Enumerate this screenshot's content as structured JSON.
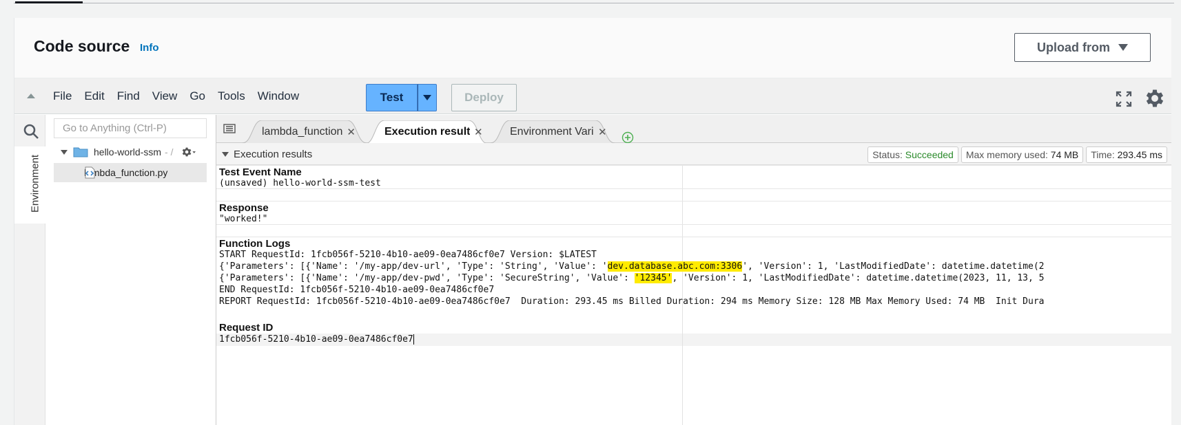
{
  "header": {
    "title": "Code source",
    "info_link": "Info",
    "upload_label": "Upload from"
  },
  "menubar": {
    "items": [
      "File",
      "Edit",
      "Find",
      "View",
      "Go",
      "Tools",
      "Window"
    ],
    "test_label": "Test",
    "deploy_label": "Deploy"
  },
  "sidebar": {
    "env_tab_label": "Environment",
    "goto_placeholder": "Go to Anything (Ctrl-P)",
    "root_folder": "hello-world-ssm",
    "root_suffix": "- /",
    "file": "lambda_function.py"
  },
  "tabs": [
    {
      "label": "lambda_function",
      "close": "✕"
    },
    {
      "label": "Execution results",
      "close": "✕"
    },
    {
      "label": "Environment Variables",
      "close": "✕"
    }
  ],
  "results": {
    "title": "Execution results",
    "status_label": "Status:",
    "status_value": "Succeeded",
    "memory_label": "Max memory used:",
    "memory_value": "74 MB",
    "time_label": "Time:",
    "time_value": "293.45 ms",
    "test_event_title": "Test Event Name",
    "test_event_value": "(unsaved) hello-world-ssm-test",
    "response_title": "Response",
    "response_value": "\"worked!\"",
    "logs_title": "Function Logs",
    "log_start": "START RequestId: 1fcb056f-5210-4b10-ae09-0ea7486cf0e7 Version: $LATEST",
    "log_p1_pre": "{'Parameters': [{'Name': '/my-app/dev-url', 'Type': 'String', 'Value': '",
    "log_p1_hl": "dev.database.abc.com:3306",
    "log_p1_post": "', 'Version': 1, 'LastModifiedDate': datetime.datetime(2",
    "log_p2_pre": "{'Parameters': [{'Name': '/my-app/dev-pwd', 'Type': 'SecureString', 'Value': ",
    "log_p2_hl": "'12345'",
    "log_p2_post": ", 'Version': 1, 'LastModifiedDate': datetime.datetime(2023, 11, 13, 5",
    "log_end": "END RequestId: 1fcb056f-5210-4b10-ae09-0ea7486cf0e7",
    "log_report": "REPORT RequestId: 1fcb056f-5210-4b10-ae09-0ea7486cf0e7  Duration: 293.45 ms Billed Duration: 294 ms Memory Size: 128 MB Max Memory Used: 74 MB  Init Dura",
    "request_id_title": "Request ID",
    "request_id_value": "1fcb056f-5210-4b10-ae09-0ea7486cf0e7"
  },
  "colors": {
    "accent": "#0073bb",
    "test_button": "#66b3ff",
    "success": "#2a8a2a",
    "highlight": "#ffeb00"
  }
}
